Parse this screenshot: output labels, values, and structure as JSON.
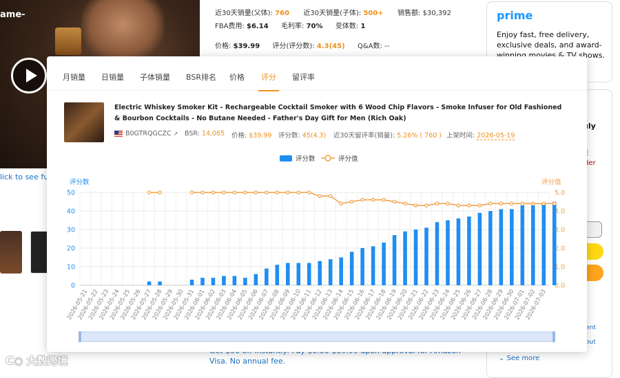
{
  "background": {
    "hero_text": "ame-",
    "click_link": "lick to see full",
    "stats": {
      "sales_parent_label": "近30天销量(父体):",
      "sales_parent_value": "760",
      "sales_child_label": "近30天销量(子体):",
      "sales_child_value": "500+",
      "revenue_label": "销售额:",
      "revenue_value": "$30,392",
      "fba_label": "FBA费用:",
      "fba_value": "$6.14",
      "margin_label": "毛利率:",
      "margin_value": "70%",
      "variants_label": "变体数:",
      "variants_value": "1",
      "price_label": "价格:",
      "price_value": "$39.99",
      "rating_label": "评分(评分数):",
      "rating_value": "4.3(45)",
      "qa_label": "Q&A数:",
      "qa_value": "--"
    },
    "prime": {
      "logo": "prime",
      "text": "Enjoy fast, free delivery, exclusive deals, and award-winning movies & TV shows."
    },
    "buy_box": {
      "july": "uly",
      "e": "E",
      "der": "der",
      "ent": "ent",
      "out": "out",
      "see_more": "See more"
    },
    "promo": "Get $50 off instantly: Pay $0.00 $39.99 upon approval for Amazon Visa. No annual fee.",
    "watermark": "大数跨境"
  },
  "popup": {
    "tabs": [
      {
        "label": "月销量",
        "active": false
      },
      {
        "label": "日销量",
        "active": false
      },
      {
        "label": "子体销量",
        "active": false
      },
      {
        "label": "BSR排名",
        "active": false
      },
      {
        "label": "价格",
        "active": false
      },
      {
        "label": "评分",
        "active": true
      },
      {
        "label": "留评率",
        "active": false
      }
    ],
    "product": {
      "title": "Electric Whiskey Smoker Kit - Rechargeable Cocktail Smoker with 6 Wood Chip Flavors - Smoke Infuser for Old Fashioned & Bourbon Cocktails - No Butane Needed - Father's Day Gift for Men (Rich Oak)",
      "asin": "B0GTRQGCZC",
      "bsr_label": "BSR:",
      "bsr_value": "14,065",
      "price_label": "价格:",
      "price_value": "$39.99",
      "ratings_label": "评分数:",
      "ratings_value": "45(4.3)",
      "review_rate_label": "近30天留评率(销量):",
      "review_rate_value": "5.26% ( 760 )",
      "listed_label": "上架时间:",
      "listed_value": "2026-05-19"
    }
  },
  "chart_data": {
    "type": "bar",
    "title": "",
    "legend": [
      "评分数",
      "评分值"
    ],
    "legend_position": "top-center",
    "left_axis_label": "评分数",
    "right_axis_label": "评分值",
    "left_ylim": [
      0,
      50
    ],
    "left_ticks": [
      0,
      10,
      20,
      30,
      40,
      50
    ],
    "right_ylim": [
      0.0,
      5.0
    ],
    "right_ticks": [
      "0.0",
      "1.0",
      "2.0",
      "3.0",
      "4.0",
      "5.0"
    ],
    "grid": true,
    "colors": {
      "bars": "#1f8ef1",
      "line": "#f0a040",
      "left_axis": "#1f8ef1",
      "right_axis": "#f0a040"
    },
    "categories": [
      "2026-05-21",
      "2026-05-22",
      "2026-05-23",
      "2026-05-24",
      "2026-05-25",
      "2026-05-26",
      "2026-05-27",
      "2026-05-28",
      "2026-05-29",
      "2026-05-30",
      "2026-05-31",
      "2026-06-01",
      "2026-06-02",
      "2026-06-03",
      "2026-06-04",
      "2026-06-05",
      "2026-06-06",
      "2026-06-07",
      "2026-06-08",
      "2026-06-09",
      "2026-06-10",
      "2026-06-11",
      "2026-06-12",
      "2026-06-13",
      "2026-06-14",
      "2026-06-15",
      "2026-06-16",
      "2026-06-17",
      "2026-06-18",
      "2026-06-19",
      "2026-06-20",
      "2026-06-21",
      "2026-06-22",
      "2026-06-23",
      "2026-06-24",
      "2026-06-25",
      "2026-06-26",
      "2026-06-27",
      "2026-06-28",
      "2026-06-29",
      "2026-06-30",
      "2026-07-01",
      "2026-07-02",
      "2026-07-03"
    ],
    "series": [
      {
        "name": "评分数",
        "kind": "bar",
        "axis": "left",
        "values": [
          null,
          null,
          null,
          null,
          null,
          null,
          2,
          2,
          null,
          null,
          3,
          4,
          4,
          5,
          5,
          4,
          6,
          9,
          11,
          12,
          12,
          12,
          13,
          14,
          15,
          18,
          20,
          21,
          23,
          27,
          29,
          30,
          31,
          34,
          35,
          36,
          37,
          39,
          40,
          41,
          41,
          43,
          43,
          44,
          45
        ]
      },
      {
        "name": "评分值",
        "kind": "line",
        "axis": "right",
        "values": [
          null,
          null,
          null,
          null,
          null,
          null,
          5.0,
          5.0,
          null,
          null,
          5.0,
          5.0,
          5.0,
          5.0,
          5.0,
          5.0,
          5.0,
          5.0,
          5.0,
          5.0,
          5.0,
          5.0,
          4.8,
          4.8,
          4.4,
          4.5,
          4.6,
          4.6,
          4.6,
          4.5,
          4.4,
          4.3,
          4.3,
          4.4,
          4.4,
          4.3,
          4.3,
          4.3,
          4.4,
          4.4,
          4.4,
          4.4,
          4.4,
          4.4,
          4.4
        ]
      }
    ]
  }
}
